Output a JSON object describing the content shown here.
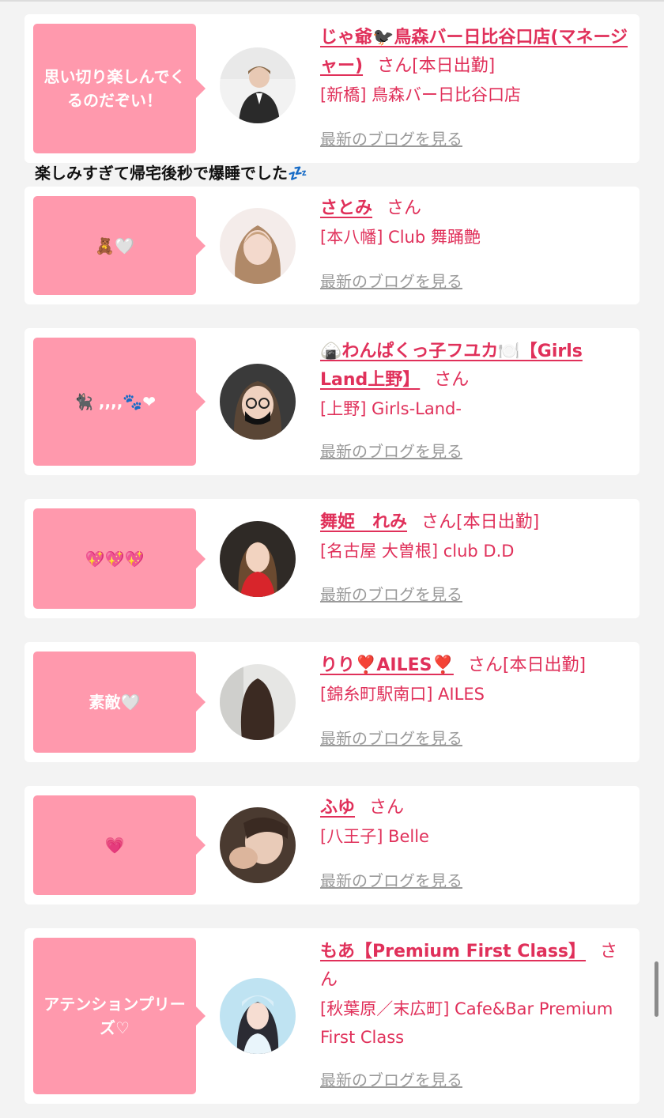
{
  "entries": [
    {
      "comment": "思い切り楽しんでくるのだぞい！",
      "name": "じゃ爺🐦‍⬛鳥森バー日比谷口店(マネージャー)",
      "honorific": "さん",
      "status": "[本日出勤]",
      "shop": "[新橋] 鳥森バー日比谷口店",
      "blog_link": "最新のブログを見る"
    },
    {
      "comment": "🧸🤍",
      "name": "さとみ",
      "honorific": "さん",
      "status": "",
      "shop": "[本八幡] Club 舞踊艶",
      "blog_link": "最新のブログを見る"
    },
    {
      "comment": "🐈‍⬛ ,,,,🐾❤",
      "name": "🍙わんぱくっ子フユカ🍽️【Girls Land上野】",
      "honorific": "さん",
      "status": "",
      "shop": "[上野] Girls-Land-",
      "blog_link": "最新のブログを見る"
    },
    {
      "comment": "💖💖💖",
      "name": "舞姫　れみ",
      "honorific": "さん",
      "status": "[本日出勤]",
      "shop": "[名古屋 大曽根] club D.D",
      "blog_link": "最新のブログを見る"
    },
    {
      "comment": "素敵🤍",
      "name": "りり❣️AILES❣️",
      "honorific": "さん",
      "status": "[本日出勤]",
      "shop": "[錦糸町駅南口] AILES",
      "blog_link": "最新のブログを見る"
    },
    {
      "comment": "💗",
      "name": "ふゆ",
      "honorific": "さん",
      "status": "",
      "shop": "[八王子] Belle",
      "blog_link": "最新のブログを見る"
    },
    {
      "comment": "アテンションプリーズ♡",
      "name": "もあ【Premium First Class】",
      "honorific": "さん",
      "status": "",
      "shop": "[秋葉原／末広町] Cafe&Bar Premium First Class",
      "blog_link": "最新のブログを見る"
    }
  ],
  "post_caption": "楽しみすぎて帰宅後秒で爆睡でした💤",
  "colors": {
    "accent": "#e0305a",
    "bubble": "#ff99ad",
    "background": "#f3f3f3",
    "card": "#ffffff",
    "muted_link": "#9a9a9a"
  }
}
